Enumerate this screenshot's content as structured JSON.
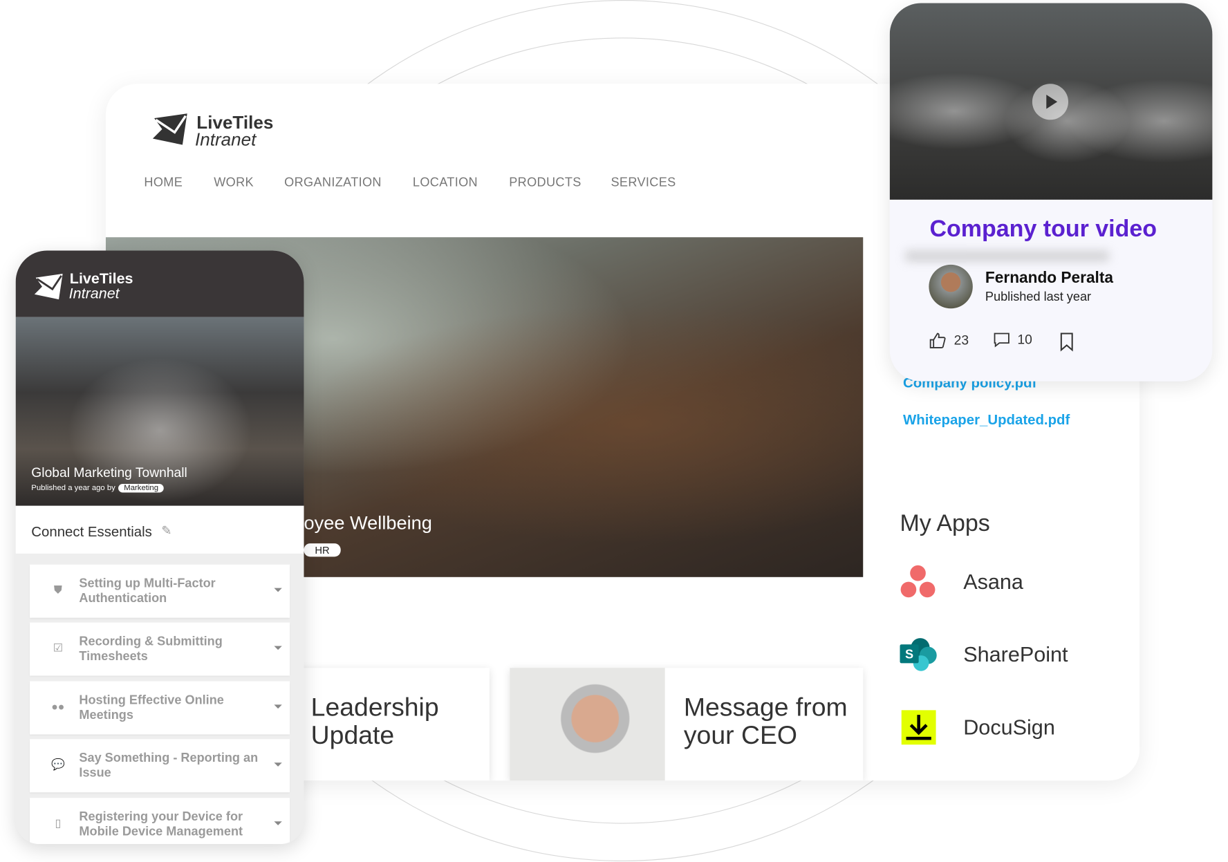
{
  "brand": {
    "line1": "LiveTiles",
    "line2": "Intranet"
  },
  "nav": [
    "HOME",
    "WORK",
    "ORGANIZATION",
    "LOCATION",
    "PRODUCTS",
    "SERVICES"
  ],
  "hero": {
    "title": "Employee Wellbeing",
    "visible_title": "oyee Wellbeing",
    "tag": "HR"
  },
  "tiles": [
    {
      "title": "Leadership Update"
    },
    {
      "title": "Message from your CEO"
    }
  ],
  "documents": [
    "Company policy.pdf",
    "Whitepaper_Updated.pdf"
  ],
  "my_apps": {
    "title": "My Apps",
    "items": [
      {
        "name": "Asana",
        "icon": "asana-icon",
        "color": "#f06a6a"
      },
      {
        "name": "SharePoint",
        "icon": "sharepoint-icon",
        "color": "#038387"
      },
      {
        "name": "DocuSign",
        "icon": "docusign-icon",
        "color": "#e2ff00"
      }
    ]
  },
  "mobile": {
    "news": {
      "title": "Global Marketing Townhall",
      "meta": "Published a year ago by",
      "tag": "Marketing"
    },
    "section_title": "Connect Essentials",
    "items": [
      {
        "label": "Setting up Multi-Factor Authentication",
        "icon": "shield-icon"
      },
      {
        "label": "Recording & Submitting Timesheets",
        "icon": "checkbox-icon"
      },
      {
        "label": "Hosting Effective Online Meetings",
        "icon": "users-icon"
      },
      {
        "label": "Say Something - Reporting an Issue",
        "icon": "chat-icon"
      },
      {
        "label": "Registering your Device for Mobile Device Management",
        "icon": "mobile-icon"
      }
    ]
  },
  "video_card": {
    "title": "Company tour video",
    "author": "Fernando Peralta",
    "published": "Published last year",
    "likes": "23",
    "comments": "10",
    "accent": "#5b21d0"
  }
}
